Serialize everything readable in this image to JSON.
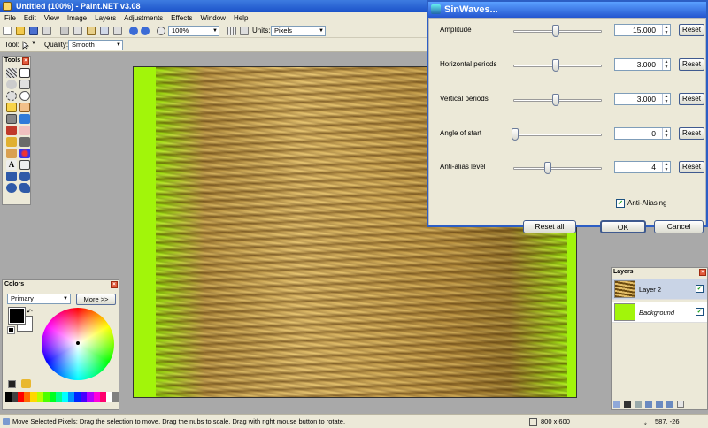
{
  "app": {
    "title": "Untitled (100%) - Paint.NET v3.08"
  },
  "menu": [
    "File",
    "Edit",
    "View",
    "Image",
    "Layers",
    "Adjustments",
    "Effects",
    "Window",
    "Help"
  ],
  "toolbar": {
    "zoom": "100%",
    "units_label": "Units:",
    "units_value": "Pixels",
    "tool_label": "Tool:",
    "quality_label": "Quality:",
    "quality_value": "Smooth"
  },
  "tools_panel": {
    "title": "Tools"
  },
  "colors_panel": {
    "title": "Colors",
    "mode": "Primary",
    "more_button": "More >>",
    "primary_color": "#000000",
    "secondary_color": "#ffffff"
  },
  "layers_panel": {
    "title": "Layers",
    "layers": [
      {
        "name": "Layer 2",
        "visible": true,
        "selected": true
      },
      {
        "name": "Background",
        "visible": true,
        "selected": false
      }
    ]
  },
  "dialog": {
    "title": "SinWaves...",
    "params": [
      {
        "label": "Amplitude",
        "value": "15.000",
        "reset": "Reset",
        "level": 0.5
      },
      {
        "label": "Horizontal periods",
        "value": "3.000",
        "reset": "Reset",
        "level": 0.5
      },
      {
        "label": "Vertical periods",
        "value": "3.000",
        "reset": "Reset",
        "level": 0.5
      },
      {
        "label": "Angle of start",
        "value": "0",
        "reset": "Reset",
        "level": 0.0
      },
      {
        "label": "Anti-alias level",
        "value": "4",
        "reset": "Reset",
        "level": 0.4
      }
    ],
    "antialias_label": "Anti-Aliasing",
    "antialias_checked": true,
    "reset_all": "Reset all",
    "ok": "OK",
    "cancel": "Cancel"
  },
  "canvas": {
    "background_color": "#a2f50a"
  },
  "status": {
    "message": "Move Selected Pixels: Drag the selection to move. Drag the nubs to scale. Drag with right mouse button to rotate.",
    "image_size": "800 x 600",
    "cursor_position": "587, -26"
  }
}
